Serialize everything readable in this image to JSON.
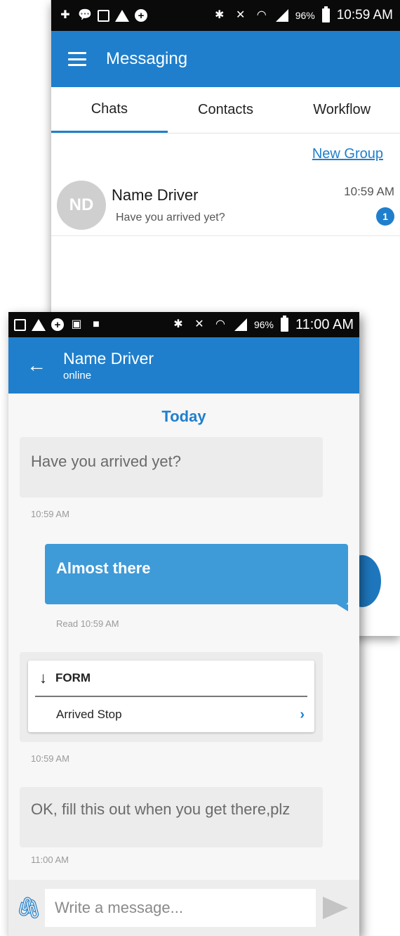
{
  "back_screen": {
    "status": {
      "battery": "96%",
      "time": "10:59 AM"
    },
    "app_title": "Messaging",
    "tabs": [
      {
        "label": "Chats",
        "active": true
      },
      {
        "label": "Contacts",
        "active": false
      },
      {
        "label": "Workflow",
        "active": false
      }
    ],
    "new_group_label": "New Group",
    "chat_list": [
      {
        "initials": "ND",
        "name": "Name Driver",
        "preview": "Have you arrived yet?",
        "time": "10:59 AM",
        "unread": "1"
      }
    ]
  },
  "front_screen": {
    "status": {
      "battery": "96%",
      "time": "11:00 AM"
    },
    "contact_name": "Name Driver",
    "contact_status": "online",
    "date_separator": "Today",
    "messages": [
      {
        "direction": "in",
        "text": "Have you arrived yet?",
        "stamp": "10:59 AM"
      },
      {
        "direction": "out",
        "text": "Almost there",
        "stamp": "Read 10:59 AM"
      },
      {
        "direction": "in",
        "type": "form",
        "form_title": "FORM",
        "form_item": "Arrived Stop",
        "stamp": "10:59 AM"
      },
      {
        "direction": "in",
        "text": "OK, fill this out when you get there,plz",
        "stamp": "11:00 AM"
      }
    ],
    "composer_placeholder": "Write a message..."
  },
  "colors": {
    "primary": "#1f7fcc",
    "outgoing_bubble": "#3f9ad8",
    "incoming_bubble": "#ececec"
  }
}
